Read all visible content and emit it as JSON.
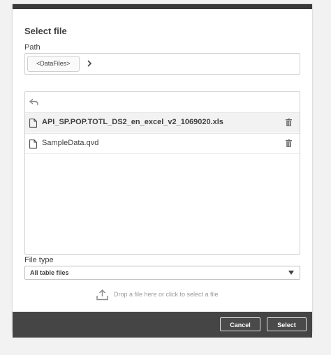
{
  "dialog": {
    "title": "Select file",
    "path_label": "Path",
    "breadcrumb": "<DataFiles>",
    "breadcrumb_chevron_icon": "chevron-right-icon",
    "back_icon": "undo-arrow-icon",
    "files": [
      {
        "name": "API_SP.POP.TOTL_DS2_en_excel_v2_1069020.xls",
        "selected": true,
        "icon": "file-icon",
        "action_icon": "trash-icon"
      },
      {
        "name": "SampleData.qvd",
        "selected": false,
        "icon": "file-icon",
        "action_icon": "trash-icon"
      }
    ],
    "file_type_label": "File type",
    "file_type_value": "All table files",
    "drop_text": "Drop a file here or click to select a file",
    "drop_icon": "upload-icon",
    "cancel_label": "Cancel",
    "select_label": "Select"
  },
  "colors": {
    "header_bar": "#3a3a3a",
    "footer": "#454545",
    "selected_row": "#f2f2f2",
    "text": "#404040"
  }
}
